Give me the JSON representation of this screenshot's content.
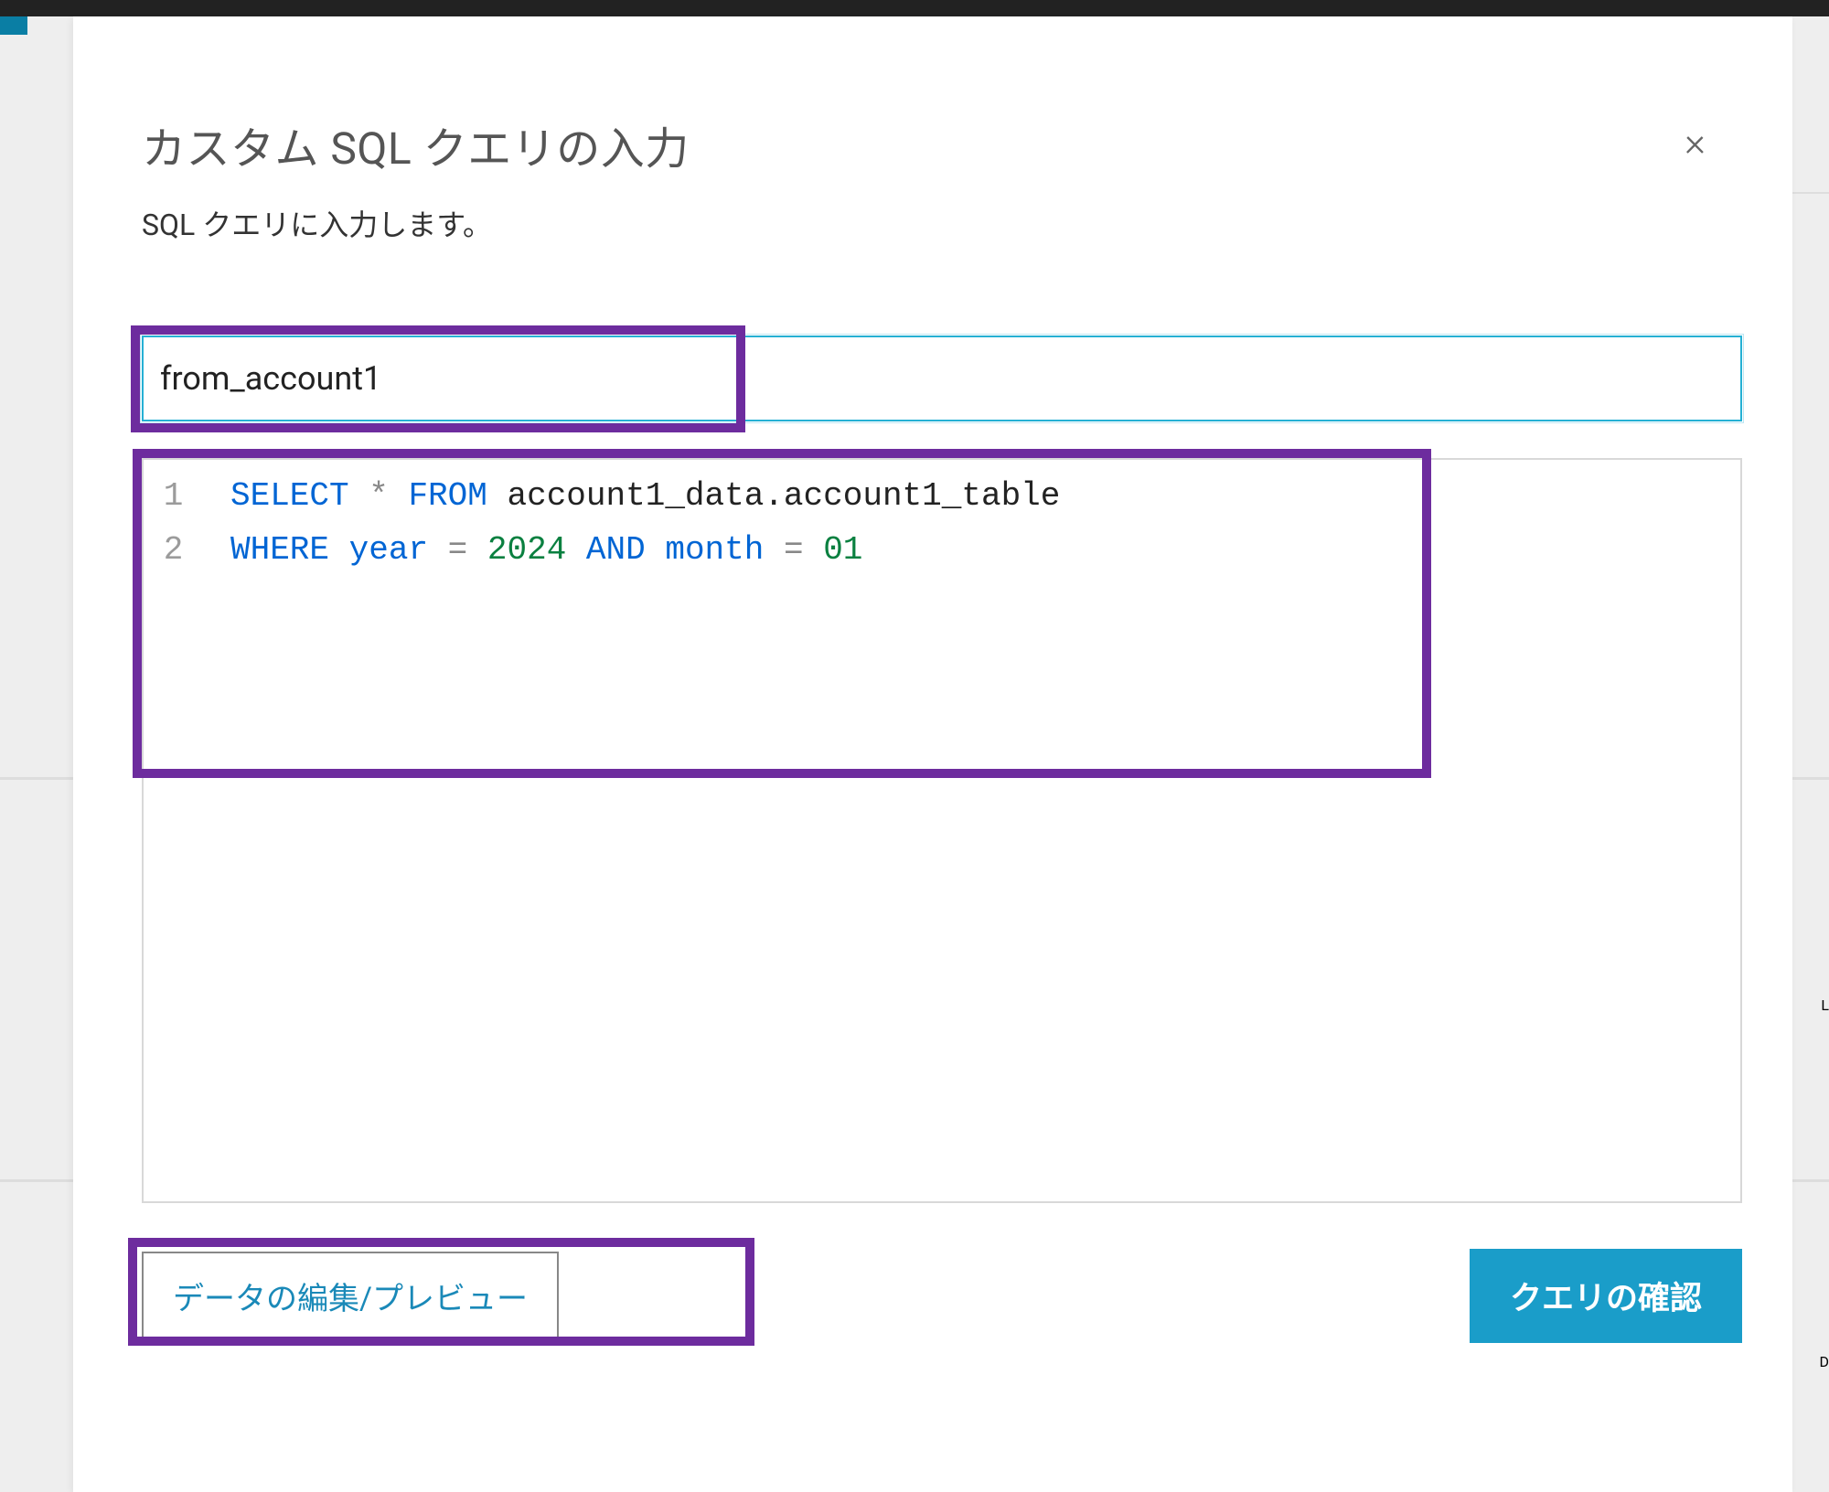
{
  "modal": {
    "title": "カスタム SQL クエリの入力",
    "subtitle": "SQL クエリに入力します。",
    "close_label": "×"
  },
  "form": {
    "query_name_value": "from_account1"
  },
  "code": {
    "lines": [
      {
        "num": "1",
        "tokens": [
          {
            "text": "SELECT",
            "cls": "kw-select"
          },
          {
            "text": " ",
            "cls": ""
          },
          {
            "text": "*",
            "cls": "star"
          },
          {
            "text": " ",
            "cls": ""
          },
          {
            "text": "FROM",
            "cls": "kw-from"
          },
          {
            "text": " ",
            "cls": ""
          },
          {
            "text": "account1_data.account1_table",
            "cls": "identifier"
          }
        ]
      },
      {
        "num": "2",
        "tokens": [
          {
            "text": "WHERE",
            "cls": "kw-where"
          },
          {
            "text": " ",
            "cls": ""
          },
          {
            "text": "year",
            "cls": "column"
          },
          {
            "text": " ",
            "cls": ""
          },
          {
            "text": "=",
            "cls": "operator"
          },
          {
            "text": " ",
            "cls": ""
          },
          {
            "text": "2024",
            "cls": "number-lit"
          },
          {
            "text": " ",
            "cls": ""
          },
          {
            "text": "AND",
            "cls": "kw-and"
          },
          {
            "text": " ",
            "cls": ""
          },
          {
            "text": "month",
            "cls": "column"
          },
          {
            "text": " ",
            "cls": ""
          },
          {
            "text": "=",
            "cls": "operator"
          },
          {
            "text": " ",
            "cls": ""
          },
          {
            "text": "01",
            "cls": "number-lit"
          }
        ]
      }
    ]
  },
  "buttons": {
    "edit_preview": "データの編集/プレビュー",
    "confirm": "クエリの確認"
  },
  "background": {
    "letter_l": "L",
    "letter_d": "D"
  }
}
